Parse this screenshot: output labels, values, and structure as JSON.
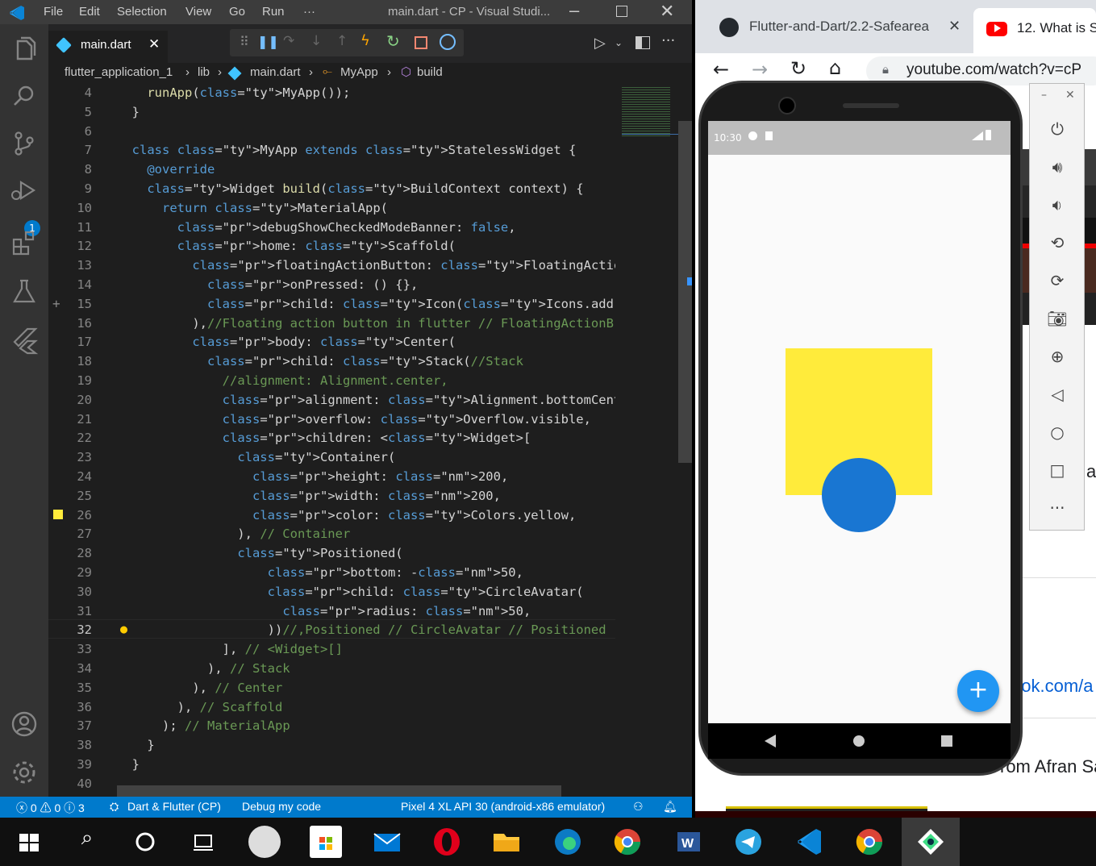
{
  "vscode": {
    "title": "main.dart - CP - Visual Studi...",
    "menu": [
      "File",
      "Edit",
      "Selection",
      "View",
      "Go",
      "Run",
      "···"
    ],
    "tab": {
      "label": "main.dart"
    },
    "breadcrumb": [
      "flutter_application_1",
      "lib",
      "main.dart",
      "MyApp",
      "build"
    ],
    "debug_badge": "1",
    "status": {
      "errors": "0",
      "warnings": "0",
      "infos": "3",
      "project": "Dart & Flutter (CP)",
      "mode": "Debug my code",
      "device": "Pixel 4 XL API 30 (android-x86 emulator)"
    },
    "line_numbers": [
      "4",
      "5",
      "6",
      "7",
      "8",
      "9",
      "10",
      "11",
      "12",
      "13",
      "14",
      "15",
      "16",
      "17",
      "18",
      "19",
      "20",
      "21",
      "22",
      "23",
      "24",
      "25",
      "26",
      "27",
      "28",
      "29",
      "30",
      "31",
      "32",
      "33",
      "34",
      "35",
      "36",
      "37",
      "38",
      "39",
      "40"
    ],
    "code": [
      "    runApp(MyApp());",
      "  }",
      "",
      "  class MyApp extends StatelessWidget {",
      "    @override",
      "    Widget build(BuildContext context) {",
      "      return MaterialApp(",
      "        debugShowCheckedModeBanner: false,",
      "        home: Scaffold(",
      "          floatingActionButton: FloatingActionButton(",
      "            onPressed: () {},",
      "            child: Icon(Icons.add),",
      "          ),//Floating action button in flutter // FloatingActionB",
      "          body: Center(",
      "            child: Stack(//Stack",
      "              //alignment: Alignment.center,",
      "              alignment: Alignment.bottomCenter,",
      "              overflow: Overflow.visible,",
      "              children: <Widget>[",
      "                Container(",
      "                  height: 200,",
      "                  width: 200,",
      "                  color: Colors.yellow,",
      "                ), // Container",
      "                Positioned(",
      "                    bottom: -50,",
      "                    child: CircleAvatar(",
      "                      radius: 50,",
      "                    ))//,Positioned // CircleAvatar // Positioned",
      "              ], // <Widget>[]",
      "            ), // Stack",
      "          ), // Center",
      "        ), // Scaffold",
      "      ); // MaterialApp",
      "    }",
      "  }",
      ""
    ]
  },
  "chrome": {
    "tab1": "Flutter-and-Dart/2.2-Safearea",
    "tab2": "12. What is S",
    "url": "youtube.com/watch?v=cP",
    "partial_text_1": "ook.com/a",
    "partial_text_2": "rom Afran Sa",
    "partial_text_3": "a"
  },
  "emulator": {
    "time": "10:30",
    "fab_label": "+",
    "container_color": "#ffeb3b",
    "avatar_color": "#1976d2",
    "fab_color": "#2196f3"
  }
}
